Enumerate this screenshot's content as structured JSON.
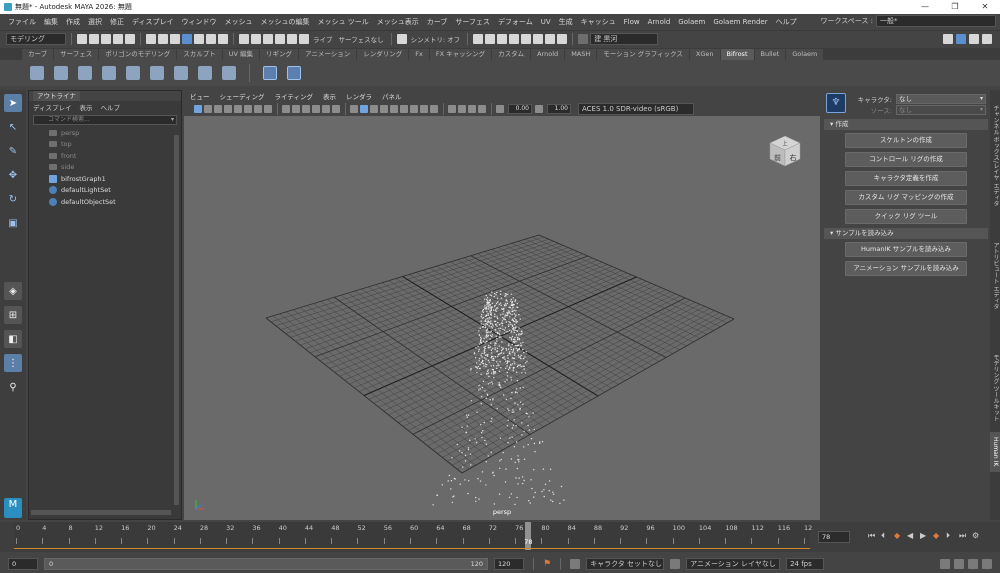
{
  "window": {
    "title": "無題* - Autodesk MAYA 2026: 無題",
    "controls": [
      "—",
      "❐",
      "✕"
    ]
  },
  "menubar": [
    "ファイル",
    "編集",
    "作成",
    "選択",
    "修正",
    "ディスプレイ",
    "ウィンドウ",
    "メッシュ",
    "メッシュの編集",
    "メッシュ ツール",
    "メッシュ表示",
    "カーブ",
    "サーフェス",
    "デフォーム",
    "UV",
    "生成",
    "キャッシュ",
    "Flow",
    "Arnold",
    "Golaem",
    "Golaem Render",
    "ヘルプ"
  ],
  "workspace": {
    "label": "ワークスペース :",
    "value": "一般*"
  },
  "statusline": {
    "mode": "モデリング",
    "live": "ライブ",
    "surface": "サーフェスなし",
    "symmetry": "シンメトリ: オフ",
    "user": "建 黒河"
  },
  "shelf_tabs": [
    "カーブ",
    "サーフェス",
    "ポリゴンのモデリング",
    "スカルプト",
    "UV 編集",
    "リギング",
    "アニメーション",
    "レンダリング",
    "Fx",
    "FX キャッシング",
    "カスタム",
    "Arnold",
    "MASH",
    "モーション グラフィックス",
    "XGen",
    "Bifrost",
    "Bullet",
    "Golaem"
  ],
  "shelf_active": "Bifrost",
  "outliner": {
    "tab": "アウトライナ",
    "menu": [
      "ディスプレイ",
      "表示",
      "ヘルプ"
    ],
    "search_placeholder": "コマンド検索...",
    "items": [
      {
        "label": "persp",
        "kind": "camera",
        "dim": true
      },
      {
        "label": "top",
        "kind": "camera",
        "dim": true
      },
      {
        "label": "front",
        "kind": "camera",
        "dim": true
      },
      {
        "label": "side",
        "kind": "camera",
        "dim": true
      },
      {
        "label": "bifrostGraph1",
        "kind": "graph",
        "dim": false
      },
      {
        "label": "defaultLightSet",
        "kind": "set",
        "dim": false
      },
      {
        "label": "defaultObjectSet",
        "kind": "set",
        "dim": false
      }
    ]
  },
  "viewport": {
    "menu": [
      "ビュー",
      "シェーディング",
      "ライティング",
      "表示",
      "レンダラ",
      "パネル"
    ],
    "exposure": "0.00",
    "gamma": "1.00",
    "colorspace": "ACES 1.0 SDR-video (sRGB)",
    "camera": "persp",
    "viewcube": {
      "top": "上",
      "front": "前",
      "right": "右"
    }
  },
  "humanik": {
    "character_label": "キャラクタ:",
    "character_value": "なし",
    "source_label": "ソース:",
    "source_value": "なし",
    "section_create": "作成",
    "create_buttons": [
      "スケルトンの作成",
      "コントロール リグの作成",
      "キャラクタ定義を作成",
      "カスタム リグ マッピングの作成",
      "クイック リグ ツール"
    ],
    "section_samples": "サンプルを読み込み",
    "sample_buttons": [
      "HumanIK サンプルを読み込み",
      "アニメーション サンプルを読み込み"
    ]
  },
  "vtabs": [
    "チャンネル ボックス/レイヤ エディタ",
    "アトリビュート エディタ",
    "モデリング ツールキット",
    "Human IK"
  ],
  "vtab_active": "Human IK",
  "timeline": {
    "ticks": [
      "0",
      "4",
      "8",
      "12",
      "16",
      "20",
      "24",
      "28",
      "32",
      "36",
      "40",
      "44",
      "48",
      "52",
      "56",
      "60",
      "64",
      "68",
      "72",
      "76",
      "80",
      "84",
      "88",
      "92",
      "96",
      "100",
      "104",
      "108",
      "112",
      "116",
      "12"
    ],
    "max": 120,
    "current": "78",
    "current_frame": 78
  },
  "range": {
    "start": "0",
    "slider_lo": "0",
    "slider_hi": "120",
    "end": "120",
    "char_set": "キャラクタ セットなし",
    "anim_layer": "アニメーション レイヤなし",
    "fps": "24 fps"
  },
  "colors": {
    "accent": "#5a8fd0",
    "range_orange": "#d48a2a"
  }
}
